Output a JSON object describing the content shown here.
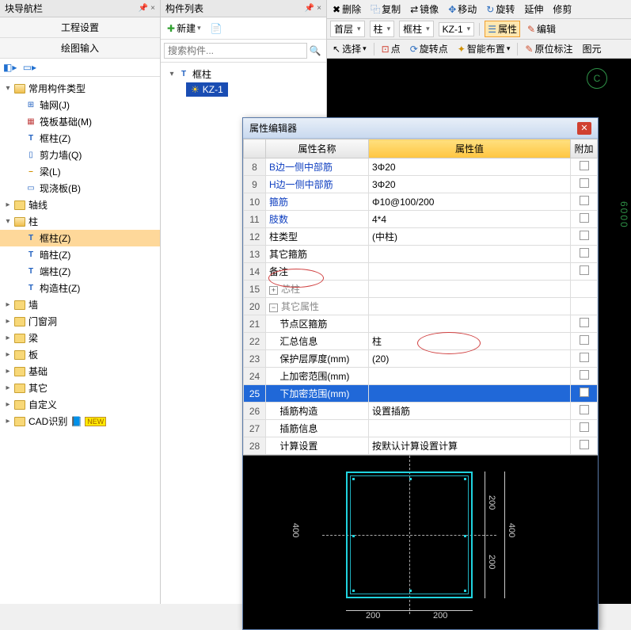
{
  "left_panel": {
    "title": "块导航栏",
    "sub1": "工程设置",
    "sub2": "绘图输入",
    "tree": {
      "root": "常用构件类型",
      "items": [
        "轴网(J)",
        "筏板基础(M)",
        "框柱(Z)",
        "剪力墙(Q)",
        "梁(L)",
        "现浇板(B)"
      ],
      "grp_axis": "轴线",
      "grp_col": "柱",
      "col_items": [
        "框柱(Z)",
        "暗柱(Z)",
        "端柱(Z)",
        "构造柱(Z)"
      ],
      "others": [
        "墙",
        "门窗洞",
        "梁",
        "板",
        "基础",
        "其它",
        "自定义",
        "CAD识别"
      ],
      "new_badge": "NEW"
    }
  },
  "mid_panel": {
    "title": "构件列表",
    "new_btn": "新建",
    "search_ph": "搜索构件...",
    "node": "框柱",
    "child": "KZ-1"
  },
  "right_toolbars": {
    "r1": {
      "del": "删除",
      "copy": "复制",
      "mirror": "镜像",
      "move": "移动",
      "rotate": "旋转",
      "extend": "延伸",
      "trim": "修剪"
    },
    "r2": {
      "floor": "首层",
      "type": "柱",
      "subtype": "框柱",
      "inst": "KZ-1",
      "prop": "属性",
      "edit": "编辑"
    },
    "r3": {
      "select": "选择",
      "point": "点",
      "rotpoint": "旋转点",
      "smart": "智能布置",
      "origin": "原位标注",
      "diagram": "图元"
    }
  },
  "cad": {
    "marker": "C",
    "dim": "6000"
  },
  "dialog": {
    "title": "属性编辑器",
    "header": {
      "name": "属性名称",
      "value": "属性值",
      "extra": "附加"
    },
    "rows": [
      {
        "n": "8",
        "name": "B边一侧中部筋",
        "val": "3Φ20",
        "blue": true,
        "chk": true
      },
      {
        "n": "9",
        "name": "H边一侧中部筋",
        "val": "3Φ20",
        "blue": true,
        "chk": true
      },
      {
        "n": "10",
        "name": "箍筋",
        "val": "Φ10@100/200",
        "blue": true,
        "chk": true
      },
      {
        "n": "11",
        "name": "肢数",
        "val": "4*4",
        "blue": true,
        "chk": true
      },
      {
        "n": "12",
        "name": "柱类型",
        "val": "(中柱)",
        "chk": true
      },
      {
        "n": "13",
        "name": "其它箍筋",
        "val": "",
        "chk": true
      },
      {
        "n": "14",
        "name": "备注",
        "val": "",
        "chk": true
      },
      {
        "n": "15",
        "name": "芯柱",
        "val": "",
        "expand": "+",
        "gray": true
      },
      {
        "n": "20",
        "name": "其它属性",
        "val": "",
        "expand": "−",
        "gray": true
      },
      {
        "n": "21",
        "name": "节点区箍筋",
        "val": "",
        "indent": true,
        "chk": true
      },
      {
        "n": "22",
        "name": "汇总信息",
        "val": "柱",
        "indent": true,
        "chk": true
      },
      {
        "n": "23",
        "name": "保护层厚度(mm)",
        "val": "(20)",
        "indent": true,
        "chk": true
      },
      {
        "n": "24",
        "name": "上加密范围(mm)",
        "val": "",
        "indent": true,
        "chk": true
      },
      {
        "n": "25",
        "name": "下加密范围(mm)",
        "val": "",
        "indent": true,
        "sel": true,
        "chk": true
      },
      {
        "n": "26",
        "name": "插筋构造",
        "val": "设置插筋",
        "indent": true,
        "chk": true
      },
      {
        "n": "27",
        "name": "插筋信息",
        "val": "",
        "indent": true,
        "chk": true
      },
      {
        "n": "28",
        "name": "计算设置",
        "val": "按默认计算设置计算",
        "indent": true,
        "chk": true
      }
    ],
    "preview": {
      "d200": "200",
      "d400": "400"
    }
  }
}
